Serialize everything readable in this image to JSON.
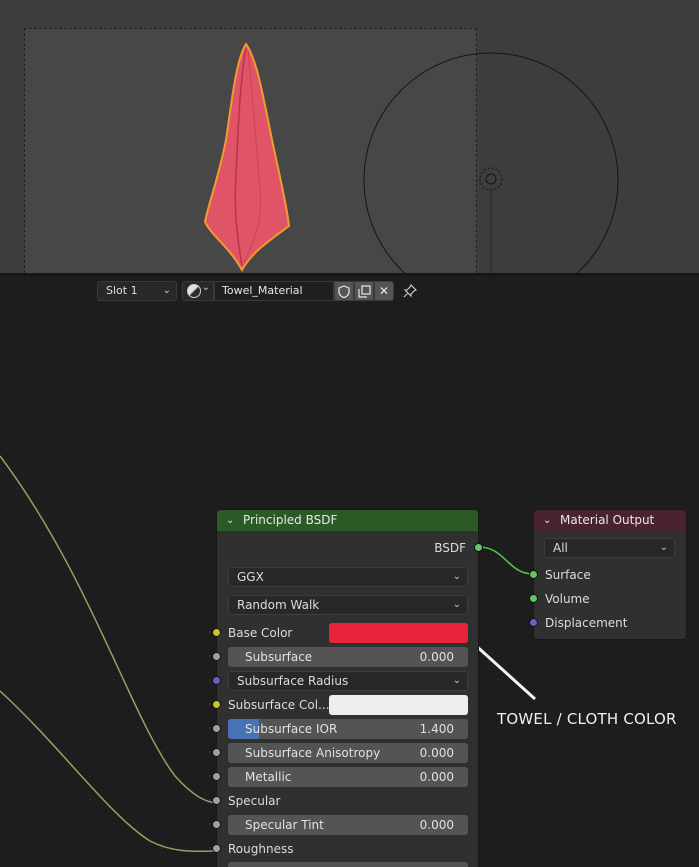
{
  "header": {
    "slot_label": "Slot 1",
    "material_name": "Towel_Material",
    "fake_user_icon": "shield-icon",
    "duplicate_icon": "duplicate-icon",
    "unlink_glyph": "✕",
    "pin_glyph": "📌"
  },
  "principled_node": {
    "title": "Principled BSDF",
    "output_label": "BSDF",
    "distribution": "GGX",
    "subsurface_method": "Random Walk",
    "base_color_label": "Base Color",
    "base_color_hex": "#e8243a",
    "subsurface": {
      "label": "Subsurface",
      "value": "0.000"
    },
    "subsurface_radius_label": "Subsurface Radius",
    "subsurface_color_label": "Subsurface Col...",
    "subsurface_color_hex": "#eeeeee",
    "subsurface_ior": {
      "label": "Subsurface IOR",
      "value": "1.400",
      "fill_fraction": 0.13
    },
    "subsurface_anisotropy": {
      "label": "Subsurface Anisotropy",
      "value": "0.000"
    },
    "metallic": {
      "label": "Metallic",
      "value": "0.000"
    },
    "specular_label": "Specular",
    "specular_tint": {
      "label": "Specular Tint",
      "value": "0.000"
    },
    "roughness_label": "Roughness"
  },
  "output_node": {
    "title": "Material Output",
    "target": "All",
    "surface_label": "Surface",
    "volume_label": "Volume",
    "displacement_label": "Displacement"
  },
  "annotation": {
    "text": "TOWEL / CLOTH COLOR"
  },
  "colors": {
    "principled_header": "#2a5a25",
    "output_header": "#4a2330",
    "towel": "#e05468",
    "selection_outline": "#f29a2e"
  }
}
